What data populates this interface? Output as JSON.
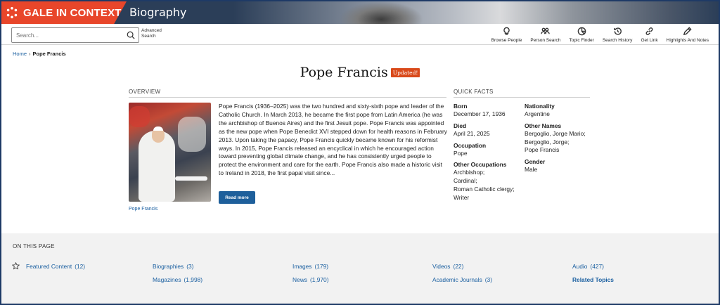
{
  "header": {
    "brand": "GALE IN CONTEXT",
    "section": "Biography",
    "accent_color": "#e8462a",
    "banner_color": "#2b3e58"
  },
  "toolbar": {
    "search_placeholder": "Search...",
    "advanced_search": "Advanced Search",
    "tools": [
      {
        "label": "Browse People",
        "icon": "bulb-icon"
      },
      {
        "label": "Person Search",
        "icon": "people-icon"
      },
      {
        "label": "Topic Finder",
        "icon": "topic-finder-icon"
      },
      {
        "label": "Search History",
        "icon": "history-icon"
      },
      {
        "label": "Get Link",
        "icon": "link-icon"
      },
      {
        "label": "Highlights And Notes",
        "icon": "pencil-icon"
      }
    ]
  },
  "breadcrumb": {
    "home": "Home",
    "current": "Pope Francis"
  },
  "page": {
    "title": "Pope Francis",
    "badge": "Updated!",
    "badge_color": "#d9491a"
  },
  "overview": {
    "heading": "OVERVIEW",
    "text": "Pope Francis (1936–2025) was the two hundred and sixty-sixth pope and leader of the Catholic Church. In March 2013, he became the first pope from Latin America (he was the archbishop of Buenos Aires) and the first Jesuit pope. Pope Francis was appointed as the new pope when Pope Benedict XVI stepped down for health reasons in February 2013. Upon taking the papacy, Pope Francis quickly became known for his reformist ways. In 2015, Pope Francis released an encyclical in which he encouraged action toward preventing global climate change, and he has consistently urged people to protect the environment and care for the earth. Pope Francis also made a historic visit to Ireland in 2018, the first papal visit since...",
    "read_more": "Read more",
    "image_caption": "Pope Francis"
  },
  "quick_facts": {
    "heading": "QUICK FACTS",
    "born_label": "Born",
    "born": "December 17, 1936",
    "died_label": "Died",
    "died": "April 21, 2025",
    "occupation_label": "Occupation",
    "occupation": "Pope",
    "other_occupations_label": "Other Occupations",
    "other_occupations": [
      "Archbishop;",
      "Cardinal;",
      "Roman Catholic clergy;",
      "Writer"
    ],
    "nationality_label": "Nationality",
    "nationality": "Argentine",
    "other_names_label": "Other Names",
    "other_names": [
      "Bergoglio, Jorge Mario;",
      "Bergoglio, Jorge;",
      "Pope Francis"
    ],
    "gender_label": "Gender",
    "gender": "Male"
  },
  "on_this_page": {
    "heading": "ON THIS PAGE",
    "featured": {
      "label": "Featured Content",
      "count": "(12)"
    },
    "biographies": {
      "label": "Biographies",
      "count": "(3)"
    },
    "images": {
      "label": "Images",
      "count": "(179)"
    },
    "videos": {
      "label": "Videos",
      "count": "(22)"
    },
    "audio": {
      "label": "Audio",
      "count": "(427)"
    },
    "magazines": {
      "label": "Magazines",
      "count": "(1,998)"
    },
    "news": {
      "label": "News",
      "count": "(1,970)"
    },
    "journals": {
      "label": "Academic Journals",
      "count": "(3)"
    },
    "related": {
      "label": "Related Topics"
    }
  }
}
